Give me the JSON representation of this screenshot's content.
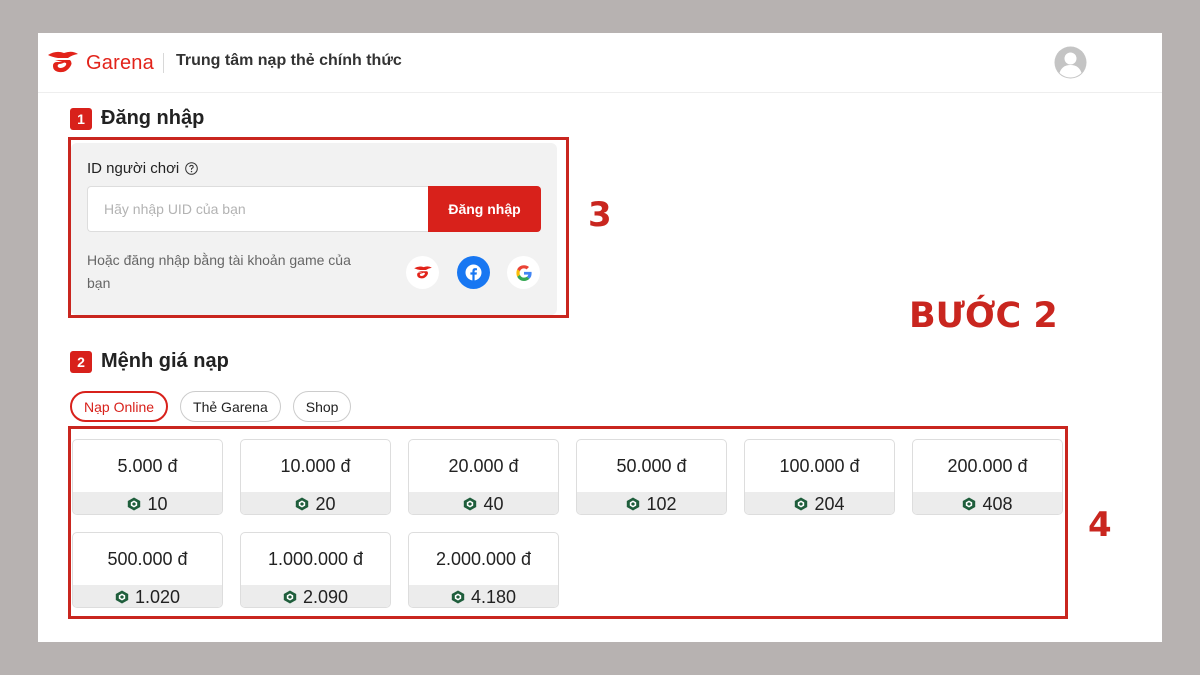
{
  "header": {
    "brand": "Garena",
    "site_title": "Trung tâm nạp thẻ chính thức"
  },
  "section1": {
    "number": "1",
    "title": "Đăng nhập",
    "id_label": "ID người chơi",
    "input_placeholder": "Hãy nhập UID của bạn",
    "input_value": "",
    "login_button": "Đăng nhập",
    "alt_login_text": "Hoặc đăng nhập bằng tài khoản game của bạn",
    "social_icons": [
      "garena-icon",
      "facebook-icon",
      "google-icon"
    ]
  },
  "section2": {
    "number": "2",
    "title": "Mệnh giá nạp",
    "tabs": [
      {
        "label": "Nạp Online",
        "active": true
      },
      {
        "label": "Thẻ Garena",
        "active": false
      },
      {
        "label": "Shop",
        "active": false
      }
    ],
    "denominations": [
      {
        "price": "5.000 đ",
        "diamonds": "10"
      },
      {
        "price": "10.000 đ",
        "diamonds": "20"
      },
      {
        "price": "20.000 đ",
        "diamonds": "40"
      },
      {
        "price": "50.000 đ",
        "diamonds": "102"
      },
      {
        "price": "100.000 đ",
        "diamonds": "204"
      },
      {
        "price": "200.000 đ",
        "diamonds": "408"
      },
      {
        "price": "500.000 đ",
        "diamonds": "1.020"
      },
      {
        "price": "1.000.000 đ",
        "diamonds": "2.090"
      },
      {
        "price": "2.000.000 đ",
        "diamonds": "4.180"
      }
    ]
  },
  "annotations": {
    "step_title": "BƯỚC 2",
    "label_3": "3",
    "label_4": "4"
  },
  "colors": {
    "brand_red": "#d8211b",
    "annotation_red": "#c9261f",
    "facebook_blue": "#1877f2",
    "gem_green": "#1f5e3c"
  }
}
